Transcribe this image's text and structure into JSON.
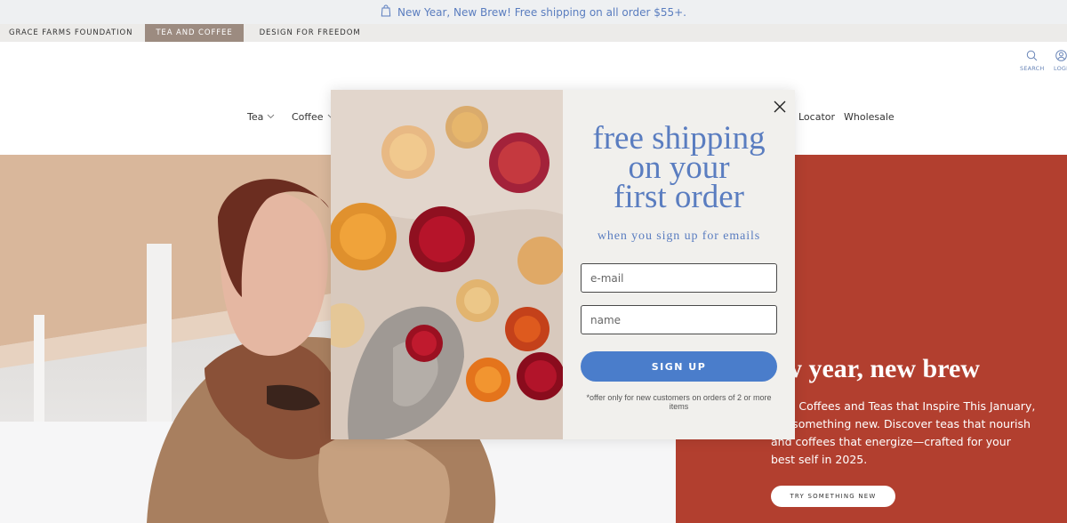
{
  "announcement": {
    "text": "New Year, New Brew! Free shipping on all order $55+.",
    "icon": "shopping-bag-icon"
  },
  "brands": [
    "GRACE FARMS FOUNDATION",
    "TEA AND COFFEE",
    "DESIGN FOR FREEDOM"
  ],
  "header": {
    "search_label": "SEARCH",
    "login_label": "LOGI"
  },
  "nav": {
    "tea": "Tea",
    "coffee": "Coffee",
    "locator": "Locator",
    "wholesale": "Wholesale"
  },
  "hero": {
    "title": "ew year, new brew",
    "text": "race Coffees and Teas that Inspire This January, ore something new. Discover teas that nourish and coffees that energize—crafted for your best self in 2025.",
    "button": "TRY SOMETHING NEW"
  },
  "popup": {
    "title_line1": "free shipping",
    "title_line2": "on your",
    "title_line3": "first order",
    "subtitle": "when you sign up for emails",
    "email_placeholder": "e-mail",
    "name_placeholder": "name",
    "button": "SIGN UP",
    "note": "*offer only for new customers on orders of 2 or more items"
  },
  "colors": {
    "accent_blue": "#5a7dc0",
    "button_blue": "#4a7dcb",
    "hero_red": "#b23f2f",
    "active_brand": "#9c8b80"
  }
}
